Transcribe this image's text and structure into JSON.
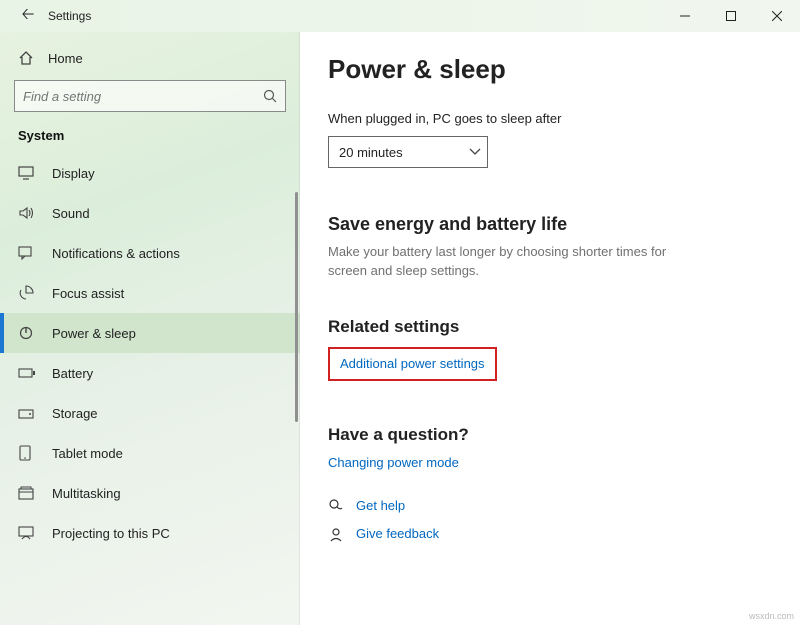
{
  "titlebar": {
    "title": "Settings"
  },
  "sidebar": {
    "home_label": "Home",
    "search_placeholder": "Find a setting",
    "section_label": "System",
    "items": [
      {
        "label": "Display"
      },
      {
        "label": "Sound"
      },
      {
        "label": "Notifications & actions"
      },
      {
        "label": "Focus assist"
      },
      {
        "label": "Power & sleep"
      },
      {
        "label": "Battery"
      },
      {
        "label": "Storage"
      },
      {
        "label": "Tablet mode"
      },
      {
        "label": "Multitasking"
      },
      {
        "label": "Projecting to this PC"
      }
    ]
  },
  "content": {
    "page_title": "Power & sleep",
    "sleep_label": "When plugged in, PC goes to sleep after",
    "sleep_value": "20 minutes",
    "energy_heading": "Save energy and battery life",
    "energy_desc": "Make your battery last longer by choosing shorter times for screen and sleep settings.",
    "related_heading": "Related settings",
    "additional_link": "Additional power settings",
    "question_heading": "Have a question?",
    "question_link": "Changing power mode",
    "gethelp_label": "Get help",
    "feedback_label": "Give feedback"
  },
  "footer": "wsxdn.com"
}
